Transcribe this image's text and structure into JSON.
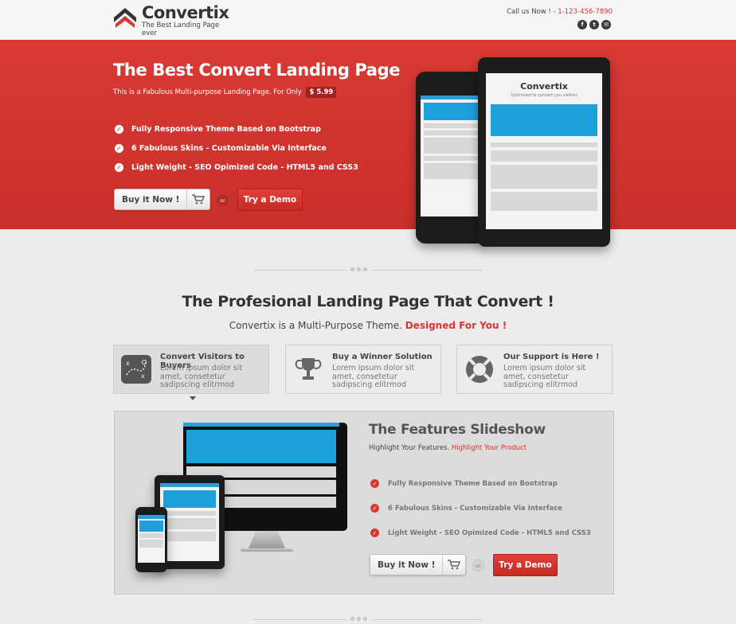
{
  "header": {
    "brand": "Convertix",
    "tagline": "The Best Landing Page ever",
    "call_label": "Call us Now ! - ",
    "phone": "1-123-456-7890",
    "social_icons": [
      "facebook-icon",
      "twitter-icon",
      "email-icon"
    ]
  },
  "hero": {
    "title": "The Best Convert Landing Page",
    "subtitle": "This is a Fabulous Multi-purpose Landing Page. For Only",
    "price": "$ 5.99",
    "features": [
      "Fully Responsive Theme Based on Bootstrap",
      "6 Fabulous Skins - Customizable Via Interface",
      "Light Weight - SEO Opimized Code - HTML5 and CSS3"
    ],
    "buy_label": "Buy it Now !",
    "or_label": "or",
    "demo_label": "Try a Demo",
    "tablet_brand": "Convertix",
    "tablet_tagline": "Optimized to convert you visitors"
  },
  "section": {
    "title": "The Profesional Landing Page That Convert !",
    "subtitle": "Convertix is a Multi-Purpose Theme.",
    "subtitle_highlight": "Designed For You !"
  },
  "features": [
    {
      "title": "Convert Visitors to Buyers",
      "desc": "Lorem ipsum dolor sit amet, consetetur sadipscing elitrmod",
      "icon": "strategy-board-icon"
    },
    {
      "title": "Buy a Winner Solution",
      "desc": "Lorem ipsum dolor sit amet, consetetur sadipscing elitrmod",
      "icon": "trophy-icon"
    },
    {
      "title": "Our Support is Here !",
      "desc": "Lorem ipsum dolor sit amet, consetetur sadipscing elitrmod",
      "icon": "lifebuoy-icon"
    }
  ],
  "slideshow": {
    "title": "The Features Slideshow",
    "subtitle": "Highlight Your Features.",
    "subtitle_highlight": "Highlight Your Product",
    "features": [
      "Fully Responsive Theme Based on Bootstrap",
      "6 Fabulous Skins - Customizable Via Interface",
      "Light Weight - SEO Opimized Code - HTML5 and CSS3"
    ],
    "buy_label": "Buy it Now !",
    "or_label": "or",
    "demo_label": "Try a Demo"
  },
  "colors": {
    "accent": "#d33a33",
    "hero_bg": "#c92f2b",
    "page_bg": "#ececec"
  }
}
